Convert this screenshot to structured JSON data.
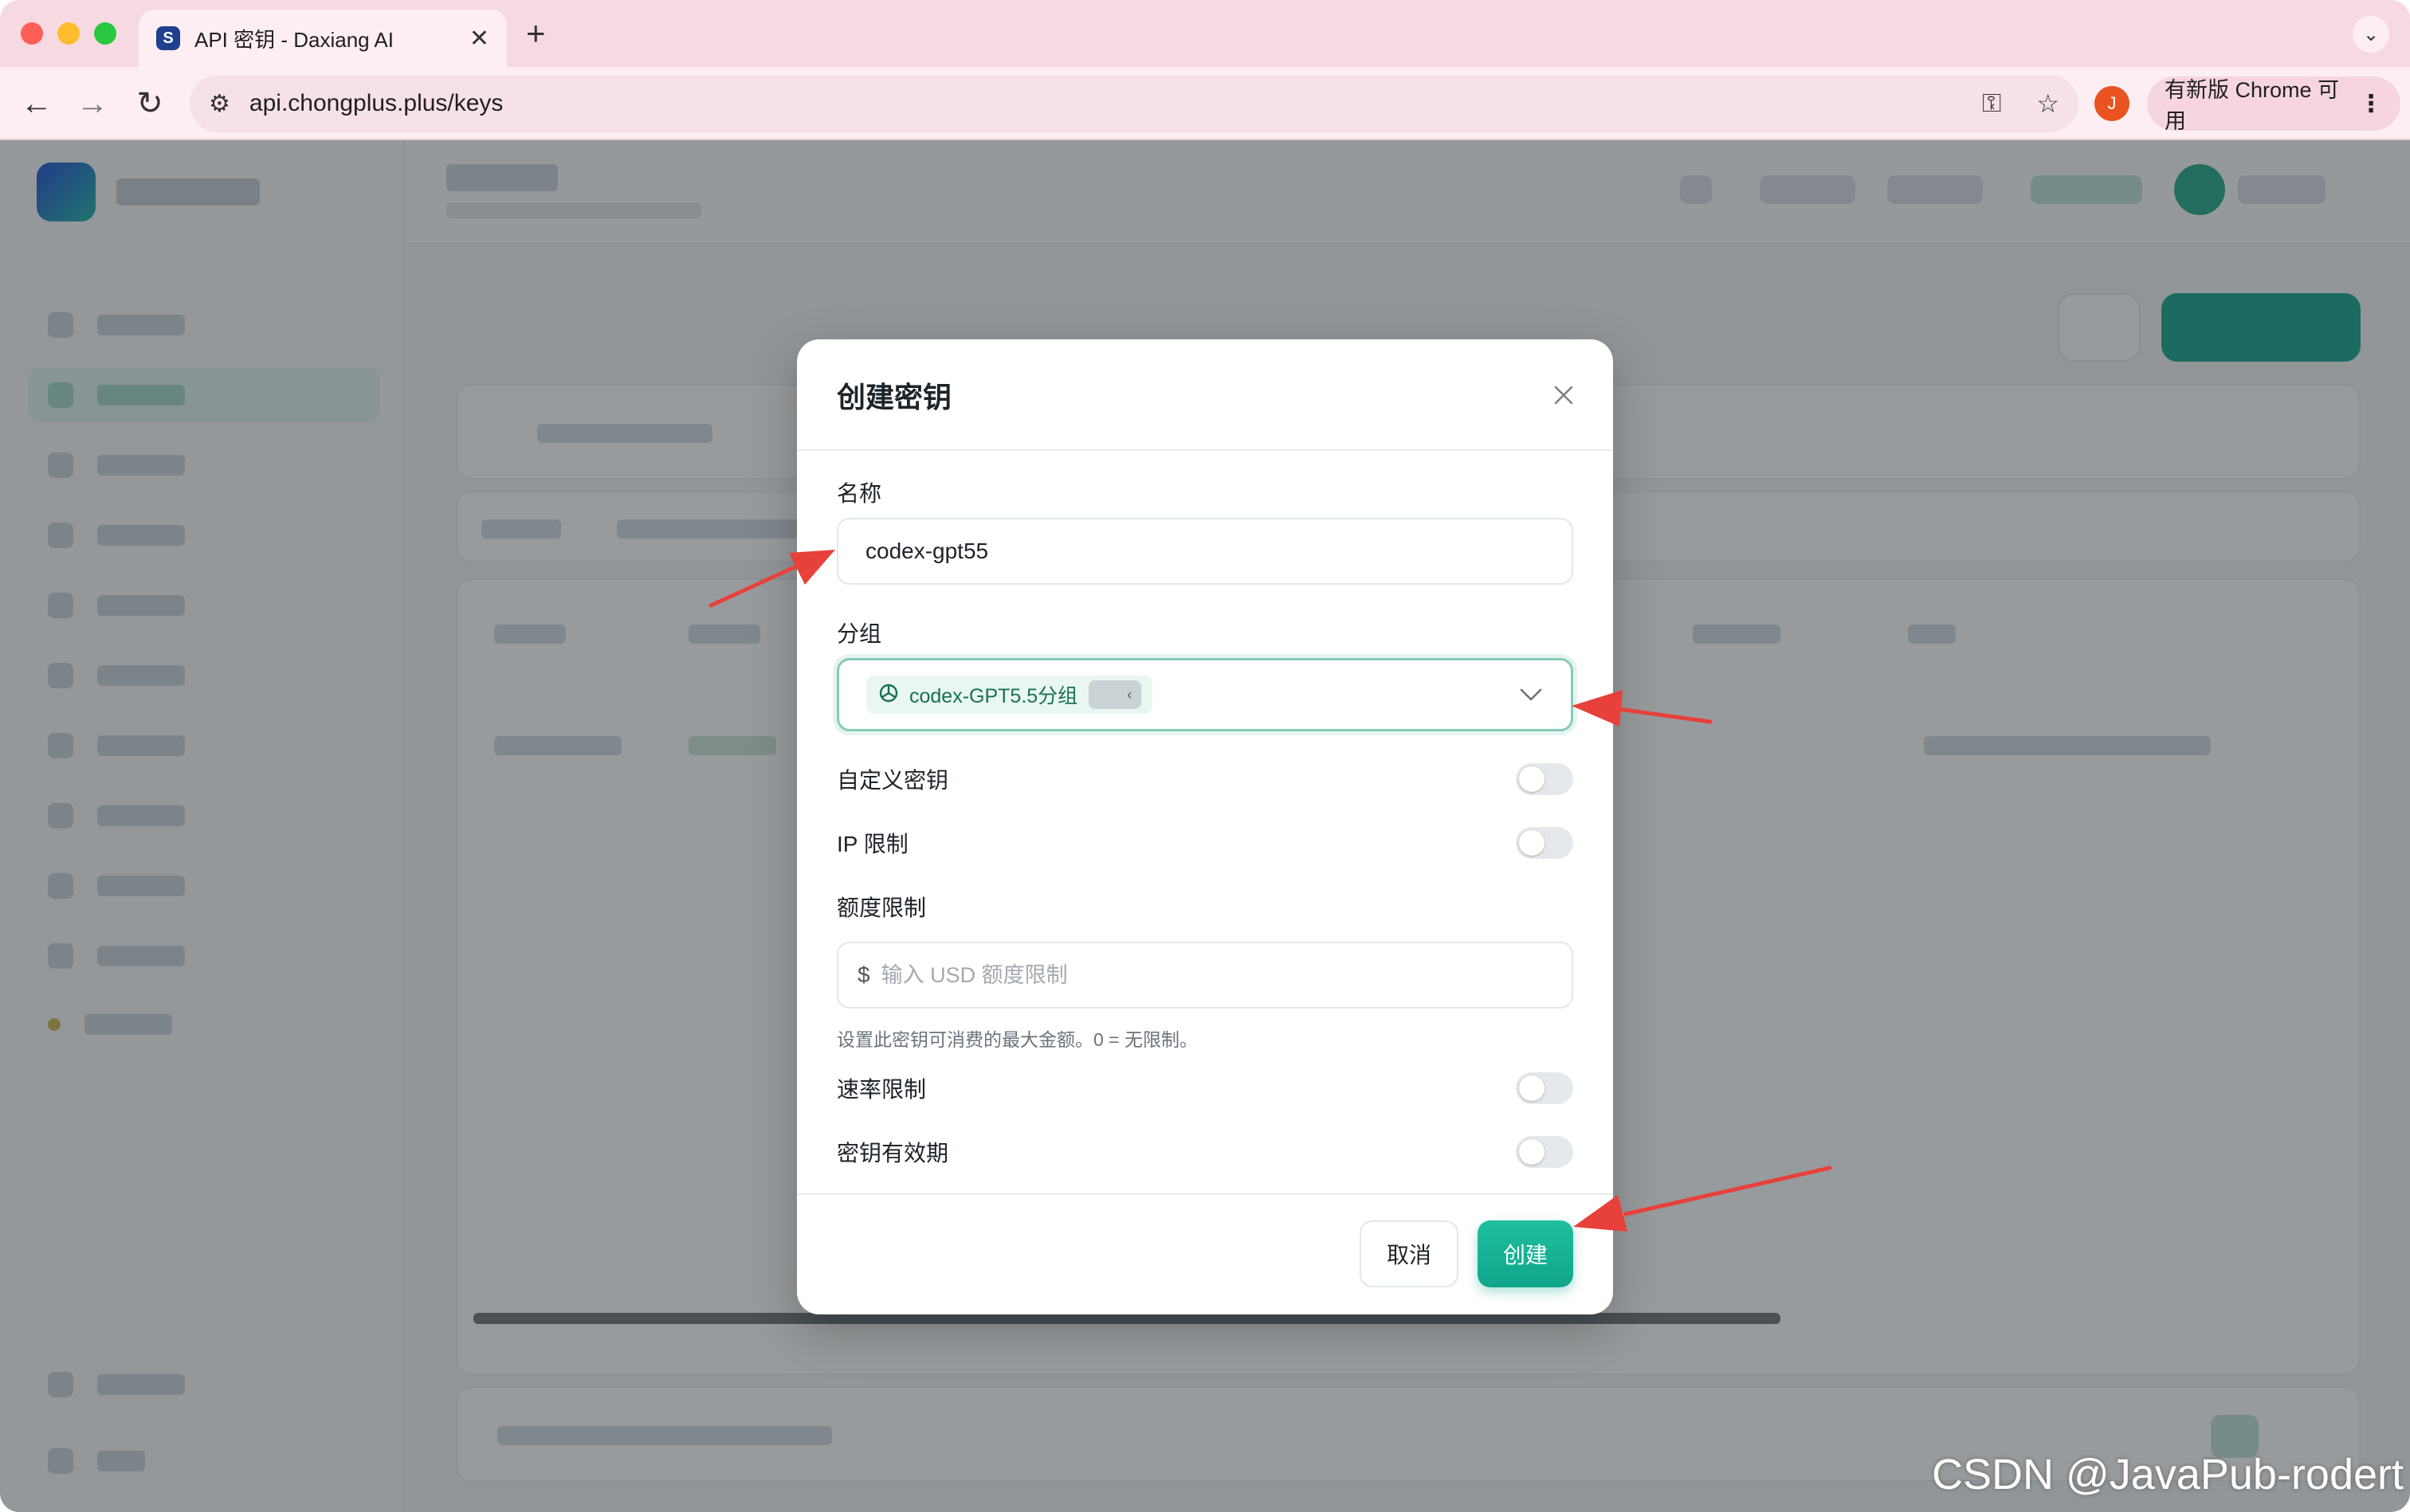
{
  "browser": {
    "tab_title": "API 密钥 - Daxiang AI",
    "url": "api.chongplus.plus/keys",
    "profile_initial": "J",
    "update_label": "有新版 Chrome 可用"
  },
  "modal": {
    "title": "创建密钥",
    "name_label": "名称",
    "name_value": "codex-gpt55",
    "group_label": "分组",
    "group_value": "codex-GPT5.5分组",
    "group_badge": "‹",
    "custom_key_label": "自定义密钥",
    "ip_limit_label": "IP 限制",
    "quota_label": "额度限制",
    "quota_currency": "$",
    "quota_placeholder": "输入 USD 额度限制",
    "quota_helper": "设置此密钥可消费的最大金额。0 = 无限制。",
    "rate_limit_label": "速率限制",
    "expiry_label": "密钥有效期",
    "cancel_label": "取消",
    "create_label": "创建",
    "toggles": {
      "custom_key": false,
      "ip_limit": false,
      "rate_limit": false,
      "expiry": false
    }
  },
  "watermark": "CSDN @JavaPub-rodert",
  "colors": {
    "accent": "#10a58a",
    "annotation_arrow": "#e8403a"
  }
}
